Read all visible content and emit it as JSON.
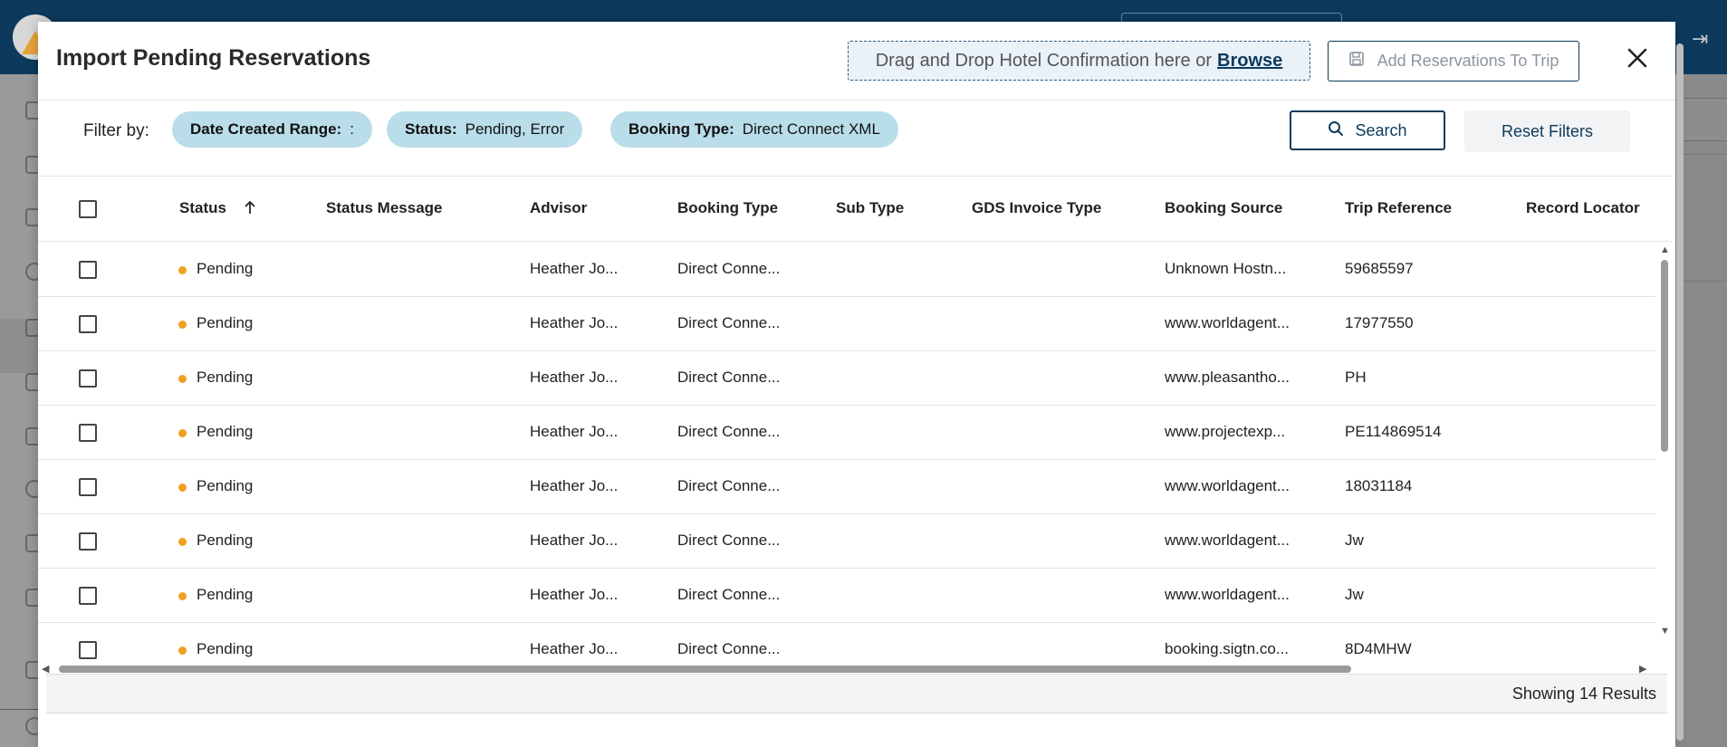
{
  "modal": {
    "title": "Import Pending Reservations",
    "dropzone_text": "Drag and Drop Hotel Confirmation here or",
    "browse_label": "Browse",
    "add_button_label": "Add Reservations To Trip",
    "close_icon": "close-icon"
  },
  "filters": {
    "label": "Filter by:",
    "chips": [
      {
        "key": "Date Created Range:",
        "value": ":"
      },
      {
        "key": "Status:",
        "value": "Pending, Error"
      },
      {
        "key": "Booking Type:",
        "value": "Direct Connect XML"
      }
    ],
    "search_label": "Search",
    "reset_label": "Reset Filters"
  },
  "table": {
    "columns": [
      "Status",
      "Status Message",
      "Advisor",
      "Booking Type",
      "Sub Type",
      "GDS Invoice Type",
      "Booking Source",
      "Trip Reference",
      "Record Locator"
    ],
    "sort_column": "Status",
    "sort_direction": "ascending",
    "rows": [
      {
        "status": "Pending",
        "status_message": "",
        "advisor": "Heather Jo...",
        "booking_type": "Direct Conne...",
        "sub_type": "",
        "gds_invoice_type": "",
        "booking_source": "Unknown Hostn...",
        "trip_reference": "59685597",
        "record_locator": ""
      },
      {
        "status": "Pending",
        "status_message": "",
        "advisor": "Heather Jo...",
        "booking_type": "Direct Conne...",
        "sub_type": "",
        "gds_invoice_type": "",
        "booking_source": "www.worldagent...",
        "trip_reference": "17977550",
        "record_locator": ""
      },
      {
        "status": "Pending",
        "status_message": "",
        "advisor": "Heather Jo...",
        "booking_type": "Direct Conne...",
        "sub_type": "",
        "gds_invoice_type": "",
        "booking_source": "www.pleasantho...",
        "trip_reference": "PH",
        "record_locator": ""
      },
      {
        "status": "Pending",
        "status_message": "",
        "advisor": "Heather Jo...",
        "booking_type": "Direct Conne...",
        "sub_type": "",
        "gds_invoice_type": "",
        "booking_source": "www.projectexp...",
        "trip_reference": "PE114869514",
        "record_locator": ""
      },
      {
        "status": "Pending",
        "status_message": "",
        "advisor": "Heather Jo...",
        "booking_type": "Direct Conne...",
        "sub_type": "",
        "gds_invoice_type": "",
        "booking_source": "www.worldagent...",
        "trip_reference": "18031184",
        "record_locator": ""
      },
      {
        "status": "Pending",
        "status_message": "",
        "advisor": "Heather Jo...",
        "booking_type": "Direct Conne...",
        "sub_type": "",
        "gds_invoice_type": "",
        "booking_source": "www.worldagent...",
        "trip_reference": "Jw",
        "record_locator": ""
      },
      {
        "status": "Pending",
        "status_message": "",
        "advisor": "Heather Jo...",
        "booking_type": "Direct Conne...",
        "sub_type": "",
        "gds_invoice_type": "",
        "booking_source": "www.worldagent...",
        "trip_reference": "Jw",
        "record_locator": ""
      },
      {
        "status": "Pending",
        "status_message": "",
        "advisor": "Heather Jo...",
        "booking_type": "Direct Conne...",
        "sub_type": "",
        "gds_invoice_type": "",
        "booking_source": "booking.sigtn.co...",
        "trip_reference": "8D4MHW",
        "record_locator": ""
      }
    ]
  },
  "footer": {
    "results_text": "Showing 14 Results"
  },
  "colors": {
    "brand_navy": "#0d3a5c",
    "chip_bg": "#b9dde9",
    "pending_dot": "#f0a020"
  }
}
